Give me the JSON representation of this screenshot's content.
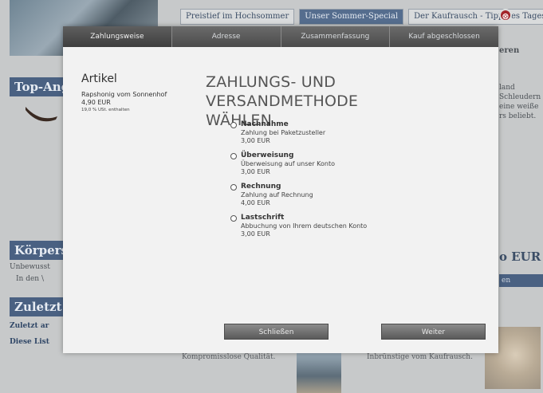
{
  "background": {
    "tabs": [
      {
        "label": "Preistief im Hochsommer",
        "active": false
      },
      {
        "label": "Unser Sommer-Special",
        "active": true
      },
      {
        "label": "Der Kaufrausch - Tipp des Tages",
        "active": false
      }
    ],
    "close_glyph": "⊗",
    "headings": {
      "top": "Top-Ang",
      "koerper": "Körpers",
      "zuletzt": "Zuletzt a"
    },
    "texts": {
      "unbewusst": "Unbewusst",
      "in_den": "In den \\",
      "zuletzt_small": "Zuletzt ar",
      "diese_liste": "Diese List",
      "lower_left": "Kompromisslose Qualität.",
      "lower_mid": "Inbrünstige vom Kaufrausch."
    },
    "right": {
      "eren": "eren",
      "line1": "land",
      "line2": "Schleudern",
      "line3": "eine weiße",
      "line4": "rs beliebt.",
      "price": "o EUR",
      "bar": "en"
    }
  },
  "modal": {
    "steps": [
      {
        "label": "Zahlungsweise",
        "active": true
      },
      {
        "label": "Adresse",
        "active": false
      },
      {
        "label": "Zusammenfassung",
        "active": false
      },
      {
        "label": "Kauf abgeschlossen",
        "active": false
      }
    ],
    "article": {
      "title": "Artikel",
      "name": "Rapshonig vom Sonnenhof",
      "price": "4,90 EUR",
      "tax": "19,0 % USt. enthalten"
    },
    "title_line1": "ZAHLUNGS- UND VERSANDMETHODE",
    "title_line2": "WÄHLEN",
    "options": [
      {
        "name": "Nachnahme",
        "desc": "Zahlung bei Paketzusteller",
        "price": "3,00 EUR"
      },
      {
        "name": "Überweisung",
        "desc": "Überweisung auf unser Konto",
        "price": "3,00 EUR"
      },
      {
        "name": "Rechnung",
        "desc": "Zahlung auf Rechnung",
        "price": "4,00 EUR"
      },
      {
        "name": "Lastschrift",
        "desc": "Abbuchung von Ihrem deutschen Konto",
        "price": "3,00 EUR"
      }
    ],
    "buttons": {
      "close": "Schließen",
      "next": "Weiter"
    }
  }
}
